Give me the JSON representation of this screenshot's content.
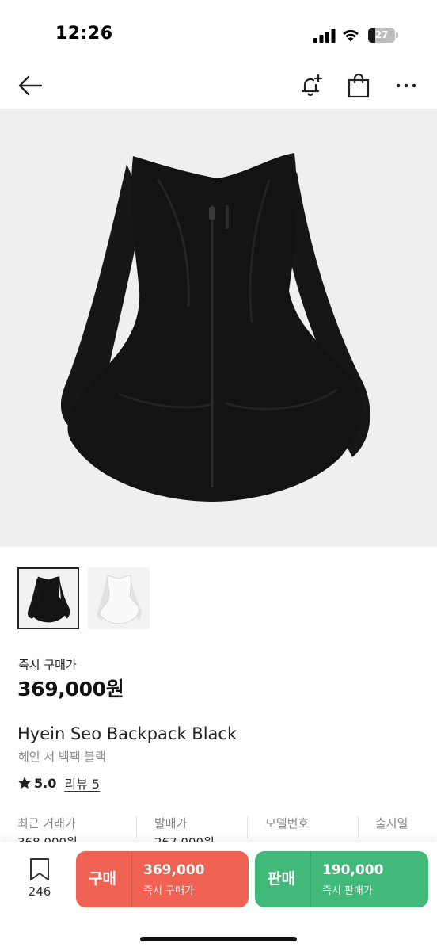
{
  "status_bar": {
    "time": "12:26",
    "battery_level": "27",
    "battery_fraction": 0.27
  },
  "nav": {
    "icons": [
      "back-arrow-icon",
      "bell-plus-icon",
      "shopping-bag-icon",
      "more-dots-icon"
    ]
  },
  "product": {
    "buy_now_label": "즉시 구매가",
    "buy_now_price": "369,000원",
    "name_en": "Hyein Seo Backpack Black",
    "name_ko": "헤인 서 백팩 블랙",
    "rating": "5.0",
    "review_label": "리뷰 5",
    "colors": {
      "hero_bg": "#efefef",
      "bag": "#141414",
      "buy_accent": "#ef6253",
      "sell_accent": "#41b979"
    },
    "thumbnails": [
      {
        "name": "black",
        "selected": true
      },
      {
        "name": "white",
        "selected": false
      }
    ]
  },
  "info": [
    {
      "label": "최근 거래가",
      "value": "368,000원"
    },
    {
      "label": "발매가",
      "value": "267,000원"
    },
    {
      "label": "모델번호",
      "value": ""
    },
    {
      "label": "출시일",
      "value": ""
    }
  ],
  "bottom": {
    "bookmark_count": "246",
    "buy": {
      "label": "구매",
      "price": "369,000",
      "sub": "즉시 구매가"
    },
    "sell": {
      "label": "판매",
      "price": "190,000",
      "sub": "즉시 판매가"
    }
  }
}
